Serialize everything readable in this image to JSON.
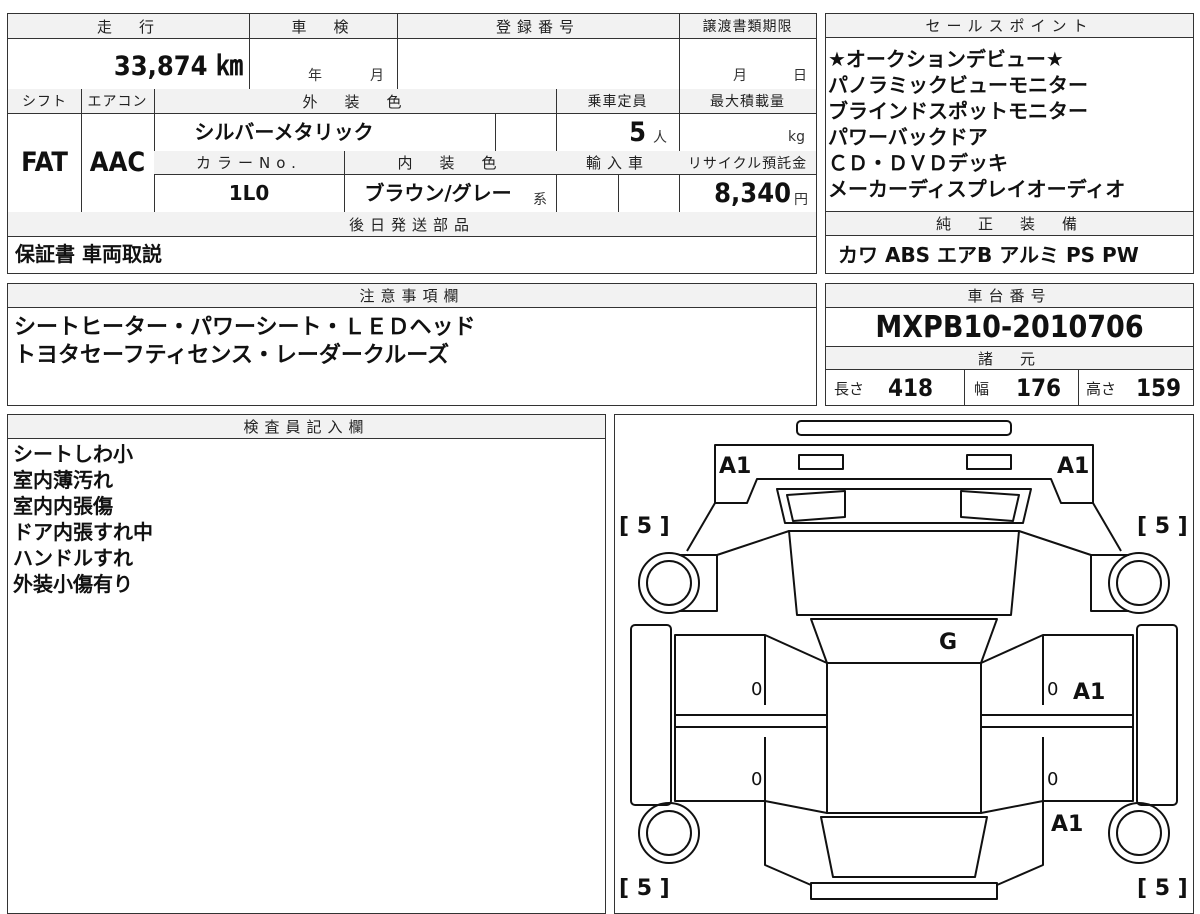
{
  "main_table": {
    "mileage_header": "走　行",
    "mileage_value": "33,874 ㎞",
    "inspection_header": "車　検",
    "inspection_year": "年",
    "inspection_month": "月",
    "registration_header": "登録番号",
    "transfer_header": "譲渡書類期限",
    "transfer_month": "月",
    "transfer_day": "日",
    "shift_header": "シフト",
    "shift_value": "FAT",
    "ac_header": "エアコン",
    "ac_value": "AAC",
    "exterior_header": "外　装　色",
    "exterior_value": "シルバーメタリック",
    "capacity_header": "乗車定員",
    "capacity_value": "5",
    "capacity_unit": "人",
    "load_header": "最大積載量",
    "load_unit": "kg",
    "color_no_header": "カラーNo.",
    "color_no_value": "1L0",
    "interior_header": "内　装　色",
    "interior_value": "ブラウン/グレー",
    "interior_suffix": "系",
    "import_header": "輸入車",
    "recycle_header": "リサイクル預託金",
    "recycle_value": "8,340",
    "recycle_unit": "円",
    "later_parts_header": "後日発送部品",
    "later_parts_value": "保証書 車両取説"
  },
  "sales_points": {
    "header": "セールスポイント",
    "items": [
      "★オークションデビュー★",
      "パノラミックビューモニター",
      "ブラインドスポットモニター",
      "パワーバックドア",
      "ＣＤ・ＤＶＤデッキ",
      "メーカーディスプレイオーディオ"
    ]
  },
  "genuine_equipment": {
    "header": "純　正　装　備",
    "value": "カワ ABS エアB アルミ PS PW"
  },
  "notes": {
    "header": "注意事項欄",
    "lines": [
      "シートヒーター・パワーシート・ＬＥＤヘッド",
      "トヨタセーフティセンス・レーダークルーズ"
    ]
  },
  "chassis": {
    "header": "車台番号",
    "value": "MXPB10-2010706"
  },
  "specs": {
    "header": "諸　元",
    "length_label": "長さ",
    "length_value": "418",
    "width_label": "幅",
    "width_value": "176",
    "height_label": "高さ",
    "height_value": "159"
  },
  "inspector": {
    "header": "検査員記入欄",
    "lines": [
      "シートしわ小",
      "室内薄汚れ",
      "室内内張傷",
      "ドア内張すれ中",
      "ハンドルすれ",
      "外装小傷有り"
    ]
  },
  "diagram": {
    "marks": {
      "front_left": "A1",
      "front_right": "A1",
      "windshield": "G",
      "right_front_door": "A1",
      "right_rear": "A1",
      "left_front_door": "0",
      "left_rear_door": "0",
      "right_front_door_zero": "0",
      "right_rear_door_zero": "0"
    },
    "tires": {
      "front_left": "[ 5 ]",
      "front_right": "[ 5 ]",
      "rear_left": "[ 5 ]",
      "rear_right": "[ 5 ]"
    }
  }
}
